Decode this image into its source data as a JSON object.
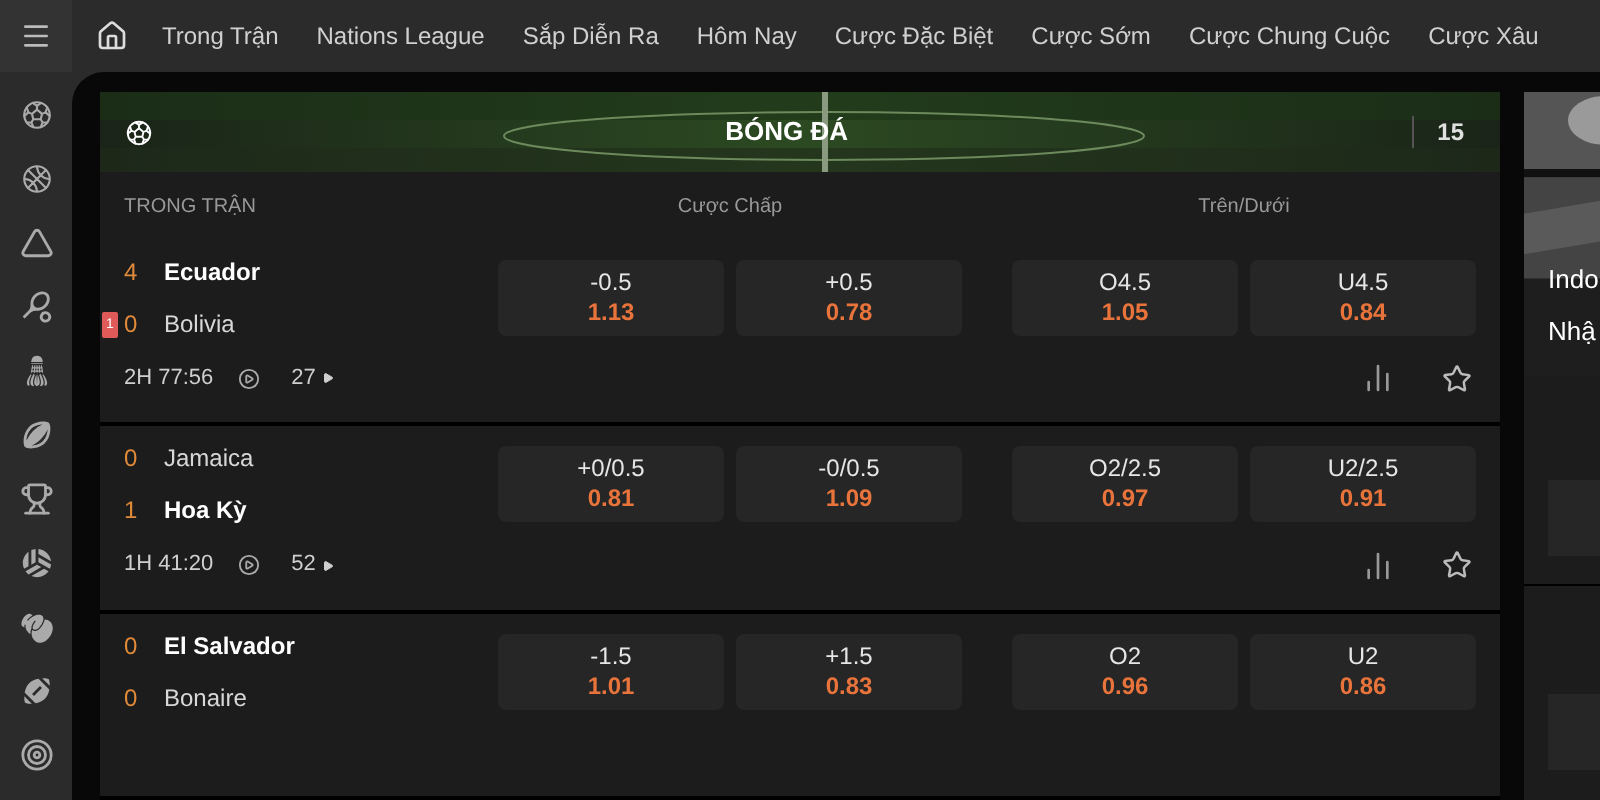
{
  "nav": {
    "items": [
      "Trong Trận",
      "Nations League",
      "Sắp Diễn Ra",
      "Hôm Nay",
      "Cược Đặc Biệt",
      "Cược Sớm",
      "Cược Chung Cuộc",
      "Cược Xâu"
    ]
  },
  "section": {
    "title": "BÓNG ĐÁ",
    "count": "15",
    "label": "TRONG TRẬN",
    "handicap_header": "Cược Chấp",
    "over_under_header": "Trên/Dưới"
  },
  "matches": [
    {
      "time": "2H 77:56",
      "count": "27",
      "teams": [
        {
          "score": "4",
          "name": "Ecuador",
          "favorite": true
        },
        {
          "score": "0",
          "name": "Bolivia",
          "favorite": false,
          "red_cards": "1"
        }
      ],
      "handicap": [
        {
          "line": "-0.5",
          "odds": "1.13"
        },
        {
          "line": "+0.5",
          "odds": "0.78"
        }
      ],
      "over_under": [
        {
          "line": "O4.5",
          "odds": "1.05"
        },
        {
          "line": "U4.5",
          "odds": "0.84"
        }
      ]
    },
    {
      "time": "1H 41:20",
      "count": "52",
      "teams": [
        {
          "score": "0",
          "name": "Jamaica",
          "favorite": false
        },
        {
          "score": "1",
          "name": "Hoa Kỳ",
          "favorite": true
        }
      ],
      "handicap": [
        {
          "line": "+0/0.5",
          "odds": "0.81"
        },
        {
          "line": "-0/0.5",
          "odds": "1.09"
        }
      ],
      "over_under": [
        {
          "line": "O2/2.5",
          "odds": "0.97"
        },
        {
          "line": "U2/2.5",
          "odds": "0.91"
        }
      ]
    },
    {
      "teams": [
        {
          "score": "0",
          "name": "El Salvador",
          "favorite": true
        },
        {
          "score": "0",
          "name": "Bonaire",
          "favorite": false
        }
      ],
      "handicap": [
        {
          "line": "-1.5",
          "odds": "1.01"
        },
        {
          "line": "+1.5",
          "odds": "0.83"
        }
      ],
      "over_under": [
        {
          "line": "O2",
          "odds": "0.96"
        },
        {
          "line": "U2",
          "odds": "0.86"
        }
      ]
    }
  ],
  "side_panel": {
    "lines": [
      "Indo",
      "Nhậ"
    ]
  }
}
